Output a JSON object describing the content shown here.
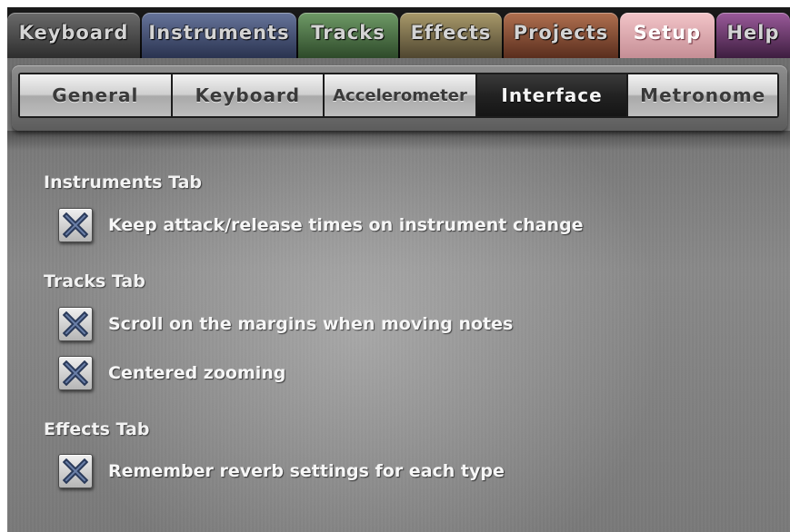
{
  "top_tabs": [
    {
      "label": "Keyboard",
      "color": "#4a4a4a",
      "active": false
    },
    {
      "label": "Instruments",
      "color": "#44506a",
      "active": false
    },
    {
      "label": "Tracks",
      "color": "#4d6b47",
      "active": false
    },
    {
      "label": "Effects",
      "color": "#756c4d",
      "active": false
    },
    {
      "label": "Projects",
      "color": "#7a4f3c",
      "active": false
    },
    {
      "label": "Setup",
      "color": "#c48c92",
      "active": true
    },
    {
      "label": "Help",
      "color": "#6a3e6b",
      "active": false
    }
  ],
  "sub_tabs": [
    {
      "label": "General",
      "active": false
    },
    {
      "label": "Keyboard",
      "active": false
    },
    {
      "label": "Accelerometer",
      "active": false
    },
    {
      "label": "Interface",
      "active": true
    },
    {
      "label": "Metronome",
      "active": false
    }
  ],
  "sections": [
    {
      "heading": "Instruments Tab",
      "options": [
        {
          "label": "Keep attack/release times on instrument change",
          "checked": true
        }
      ]
    },
    {
      "heading": "Tracks Tab",
      "options": [
        {
          "label": "Scroll on the margins when moving notes",
          "checked": true
        },
        {
          "label": "Centered zooming",
          "checked": true
        }
      ]
    },
    {
      "heading": "Effects Tab",
      "options": [
        {
          "label": "Remember reverb settings for each type",
          "checked": true
        }
      ]
    }
  ]
}
